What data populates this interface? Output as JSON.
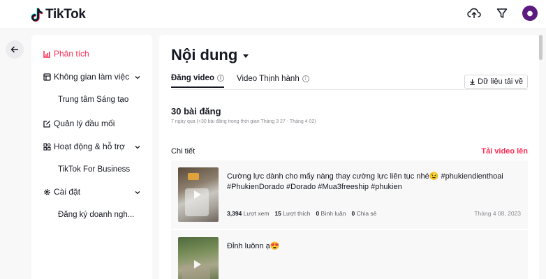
{
  "header": {
    "brand": "TikTok",
    "avatar_initial": "●"
  },
  "sidebar": {
    "items": [
      {
        "label": "Phân tích",
        "icon": "analytics-icon",
        "active": true
      },
      {
        "label": "Không gian làm việc",
        "icon": "workspace-icon"
      },
      {
        "label": "Trung tâm Sáng tạo",
        "sub": true
      },
      {
        "label": "Quản lý đầu mối",
        "icon": "leads-icon"
      },
      {
        "label": "Hoạt động & hỗ trợ",
        "icon": "activity-icon"
      },
      {
        "label": "TikTok For Business",
        "sub": true
      },
      {
        "label": "Cài đặt",
        "icon": "settings-icon"
      },
      {
        "label": "Đăng ký doanh ngh...",
        "sub": true
      }
    ]
  },
  "main": {
    "title": "Nội dung",
    "tabs": [
      {
        "label": "Đăng video",
        "active": true
      },
      {
        "label": "Video Thịnh hành",
        "active": false
      }
    ],
    "download_label": "Dữ liệu tải về",
    "post_count": "30 bài đăng",
    "post_count_sub": "7 ngày qua (+30 bài đăng trong thời gian Tháng 3 27 - Tháng 4 02)",
    "detail_label": "Chi tiết",
    "upload_label": "Tải video lên",
    "videos": [
      {
        "caption": "Cường lực dành cho mấy nàng thay cường lực liên tục nhé😉 #phukiendienthoai #PhukienDorado #Dorado #Mua3freeship #phukien",
        "views": "3,394",
        "views_label": "Lượt xem",
        "likes": "15",
        "likes_label": "Lượt thích",
        "comments": "0",
        "comments_label": "Bình luận",
        "shares": "0",
        "shares_label": "Chia sẻ",
        "date": "Tháng 4 08, 2023"
      },
      {
        "caption": "Đỉnh luônn ạ😍"
      }
    ]
  },
  "colors": {
    "accent": "#fe2c55",
    "avatar": "#5b1b80"
  }
}
